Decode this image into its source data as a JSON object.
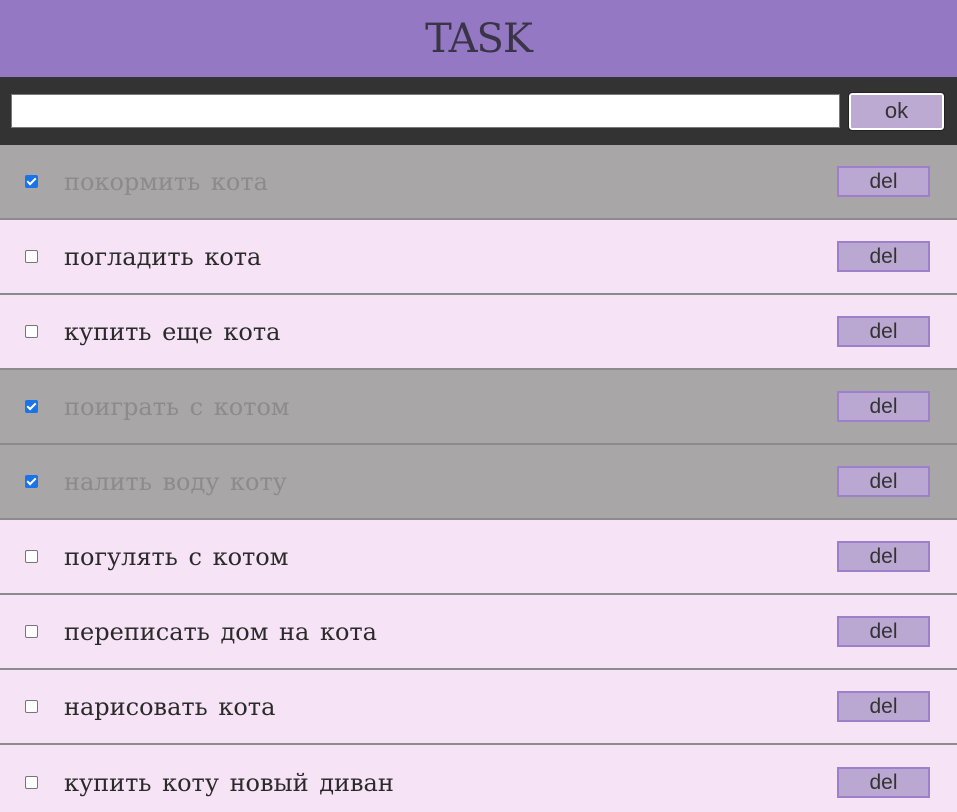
{
  "header": {
    "title": "TASK"
  },
  "input_bar": {
    "input_value": "",
    "input_placeholder": "",
    "ok_label": "ok"
  },
  "colors": {
    "header_bg": "#9478c4",
    "input_bar_bg": "#333333",
    "task_bg": "#f6e3f5",
    "task_done_bg": "#a8a6a7",
    "button_bg": "#bba8d2"
  },
  "tasks": [
    {
      "text": "покормить кота",
      "done": true,
      "del_label": "del"
    },
    {
      "text": "погладить кота",
      "done": false,
      "del_label": "del"
    },
    {
      "text": "купить еще кота",
      "done": false,
      "del_label": "del"
    },
    {
      "text": "поиграть с котом",
      "done": true,
      "del_label": "del"
    },
    {
      "text": "налить воду коту",
      "done": true,
      "del_label": "del"
    },
    {
      "text": "погулять с котом",
      "done": false,
      "del_label": "del"
    },
    {
      "text": "переписать дом на кота",
      "done": false,
      "del_label": "del"
    },
    {
      "text": "нарисовать кота",
      "done": false,
      "del_label": "del"
    },
    {
      "text": "купить коту новый диван",
      "done": false,
      "del_label": "del"
    }
  ]
}
